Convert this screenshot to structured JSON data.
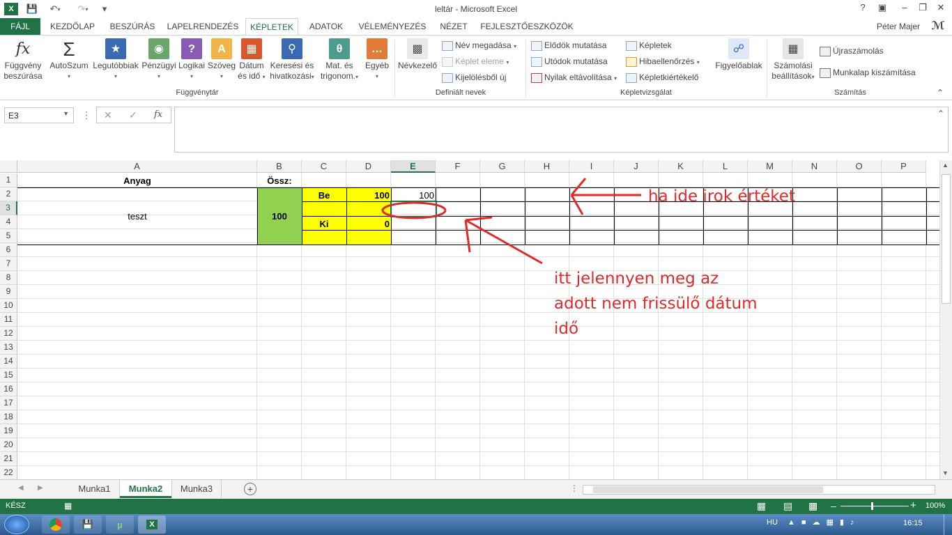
{
  "window": {
    "title": "leltár - Microsoft Excel",
    "user": "Péter Majer"
  },
  "tabs": [
    "FÁJL",
    "KEZDŐLAP",
    "BESZÚRÁS",
    "LAPELRENDEZÉS",
    "KÉPLETEK",
    "ADATOK",
    "VÉLEMÉNYEZÉS",
    "NÉZET",
    "FEJLESZTŐESZKÖZÖK"
  ],
  "ribbon": {
    "function_library": {
      "insert_function": [
        "Függvény",
        "beszúrása"
      ],
      "autosum": "AutoSzum",
      "recent": "Legutóbbiak",
      "financial": "Pénzügyi",
      "logical": "Logikai",
      "text": "Szöveg",
      "datetime": [
        "Dátum",
        "és idő"
      ],
      "lookup": [
        "Keresési és",
        "hivatkozási"
      ],
      "math": [
        "Mat. és",
        "trigonom."
      ],
      "more": "Egyéb",
      "label": "Függvénytár"
    },
    "defined_names": {
      "name_manager": "Névkezelő",
      "define_name": "Név megadása",
      "use_in_formula": "Képlet eleme",
      "create_from_selection": "Kijelölésből új",
      "label": "Definiált nevek"
    },
    "formula_auditing": {
      "trace_precedents": "Elődök mutatása",
      "trace_dependents": "Utódok mutatása",
      "remove_arrows": "Nyilak eltávolítása",
      "show_formulas": "Képletek",
      "error_checking": "Hibaellenőrzés",
      "evaluate_formula": "Képletkiértékelő",
      "watch_window": "Figyelőablak",
      "label": "Képletvizsgálat"
    },
    "calculation": {
      "options": [
        "Számolási",
        "beállítások"
      ],
      "calc_now": "Újraszámolás",
      "calc_sheet": "Munkalap kiszámítása",
      "label": "Számítás"
    }
  },
  "formula_bar": {
    "name_box": "E3",
    "formula": ""
  },
  "columns": [
    "A",
    "B",
    "C",
    "D",
    "E",
    "F",
    "G",
    "H",
    "I",
    "J",
    "K",
    "L",
    "M",
    "N",
    "O",
    "P"
  ],
  "rows": [
    "1",
    "2",
    "3",
    "4",
    "5",
    "6",
    "7",
    "8",
    "9",
    "10",
    "11",
    "12",
    "13",
    "14",
    "15",
    "16",
    "17",
    "18",
    "19",
    "20",
    "21",
    "22"
  ],
  "cells": {
    "A1": "Anyag",
    "B1": "Össz:",
    "A2": "teszt",
    "B2": "100",
    "C2": "Be",
    "D2": "100",
    "E2": "100",
    "C4": "Ki",
    "D4": "0"
  },
  "sheets": [
    "Munka1",
    "Munka2",
    "Munka3"
  ],
  "active_sheet": "Munka2",
  "status": {
    "mode": "KÉSZ",
    "zoom": "100%"
  },
  "taskbar": {
    "lang": "HU",
    "time": "16:15"
  },
  "annotations": {
    "arrow1_text": "ha ide irok értéket",
    "arrow2_line1": "itt jelennyen meg az",
    "arrow2_line2": "adott nem frissülő dátum",
    "arrow2_line3": "idő"
  },
  "colors": {
    "excel_green": "#217346",
    "yellow": "#ffff00",
    "green_cell": "#92d050",
    "annotation_red": "#e02a2a"
  }
}
